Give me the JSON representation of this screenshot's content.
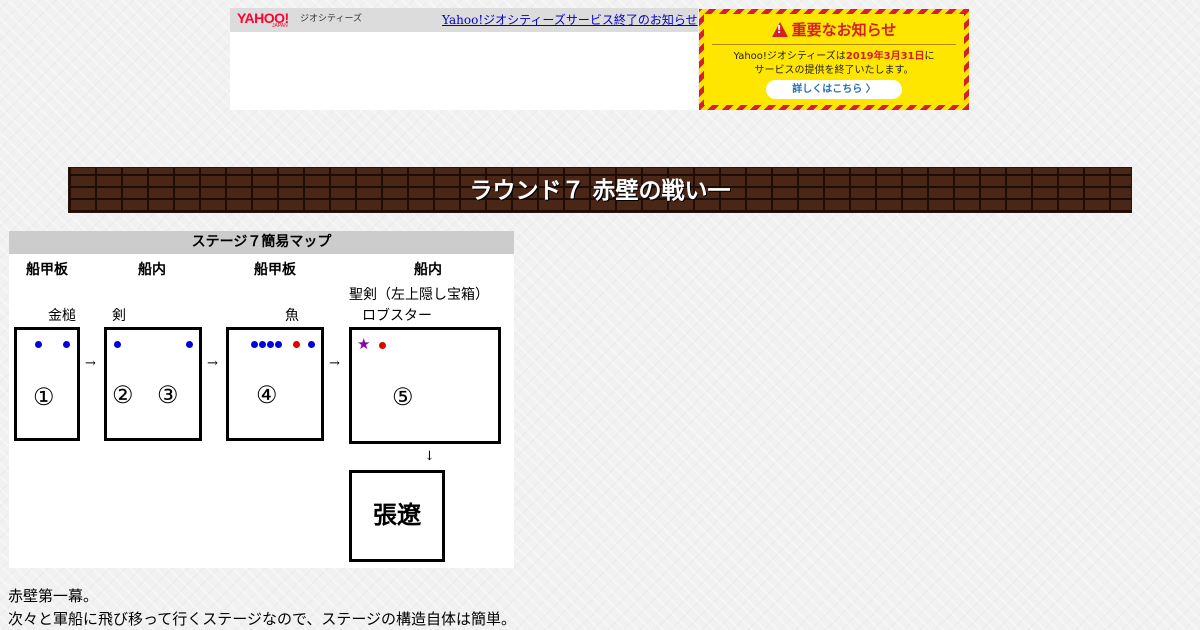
{
  "yahoo_banner": {
    "logo": "YAHOO!",
    "logo_sub": "JAPAN",
    "geocities_label": "ジオシティーズ",
    "notice_link": "Yahoo!ジオシティーズサービス終了のお知らせ"
  },
  "warning_box": {
    "title": "重要なお知らせ",
    "text_prefix": "Yahoo!ジオシティーズは",
    "text_date": "2019年3月31日",
    "text_suffix": "に",
    "text_line2": "サービスの提供を終了いたします。",
    "details_button": "詳しくはこちら 〉",
    "colors": {
      "stripe_red": "#d4202a",
      "yellow": "#ffe600",
      "button_text": "#2b6fb5"
    }
  },
  "round_title": "ラウンド７ 赤壁の戦い一",
  "map": {
    "title": "ステージ７簡易マップ",
    "columns": [
      "船甲板",
      "船内",
      "船甲板",
      "船内"
    ],
    "items": {
      "hammer": "金槌",
      "sword": "剣",
      "fish": "魚",
      "holy_sword": "聖剣（左上隠し宝箱）",
      "lobster": "ロブスター"
    },
    "areas": [
      "①",
      "②",
      "③",
      "④",
      "⑤"
    ],
    "arrow_right": "→",
    "arrow_down": "↓",
    "star": "★",
    "boss": "張遼",
    "colors": {
      "blue_dot": "#0000dd",
      "red_dot": "#e00000",
      "star": "#8a00aa"
    }
  },
  "body": {
    "line1": "赤壁第一幕。",
    "line2": "次々と軍船に飛び移って行くステージなので、ステージの構造自体は簡単。"
  }
}
